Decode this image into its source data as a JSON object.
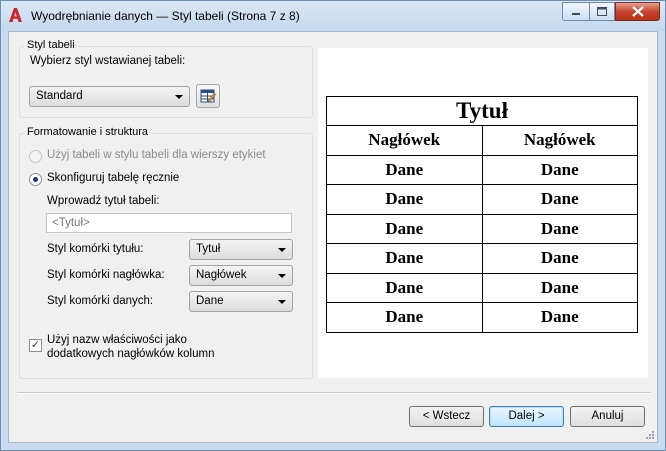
{
  "window": {
    "title": "Wyodrębnianie danych — Styl tabeli (Strona 7 z 8)",
    "icon": "autocad-a-icon",
    "accent_color": "#c7442d"
  },
  "table_style": {
    "group_label": "Styl tabeli",
    "prompt": "Wybierz styl wstawianej tabeli:",
    "selected": "Standard"
  },
  "formatting": {
    "group_label": "Formatowanie i struktura",
    "option_table_style": "Użyj tabeli w stylu tabeli dla wierszy etykiet",
    "option_manual": "Skonfiguruj tabelę ręcznie",
    "title_prompt": "Wprowadź tytuł tabeli:",
    "title_placeholder": "<Tytuł>",
    "title_cell_label": "Styl komórki tytułu:",
    "title_cell_value": "Tytuł",
    "header_cell_label": "Styl komórki nagłówka:",
    "header_cell_value": "Nagłówek",
    "data_cell_label": "Styl komórki danych:",
    "data_cell_value": "Dane",
    "use_props_line1": "Użyj nazw właściwości jako",
    "use_props_line2": "dodatkowych nagłówków kolumn",
    "use_props_checked": true
  },
  "preview": {
    "title": "Tytuł",
    "headers": [
      "Nagłówek",
      "Nagłówek"
    ],
    "rows": [
      [
        "Dane",
        "Dane"
      ],
      [
        "Dane",
        "Dane"
      ],
      [
        "Dane",
        "Dane"
      ],
      [
        "Dane",
        "Dane"
      ],
      [
        "Dane",
        "Dane"
      ],
      [
        "Dane",
        "Dane"
      ]
    ]
  },
  "buttons": {
    "back": "< Wstecz",
    "next": "Dalej >",
    "cancel": "Anuluj"
  }
}
